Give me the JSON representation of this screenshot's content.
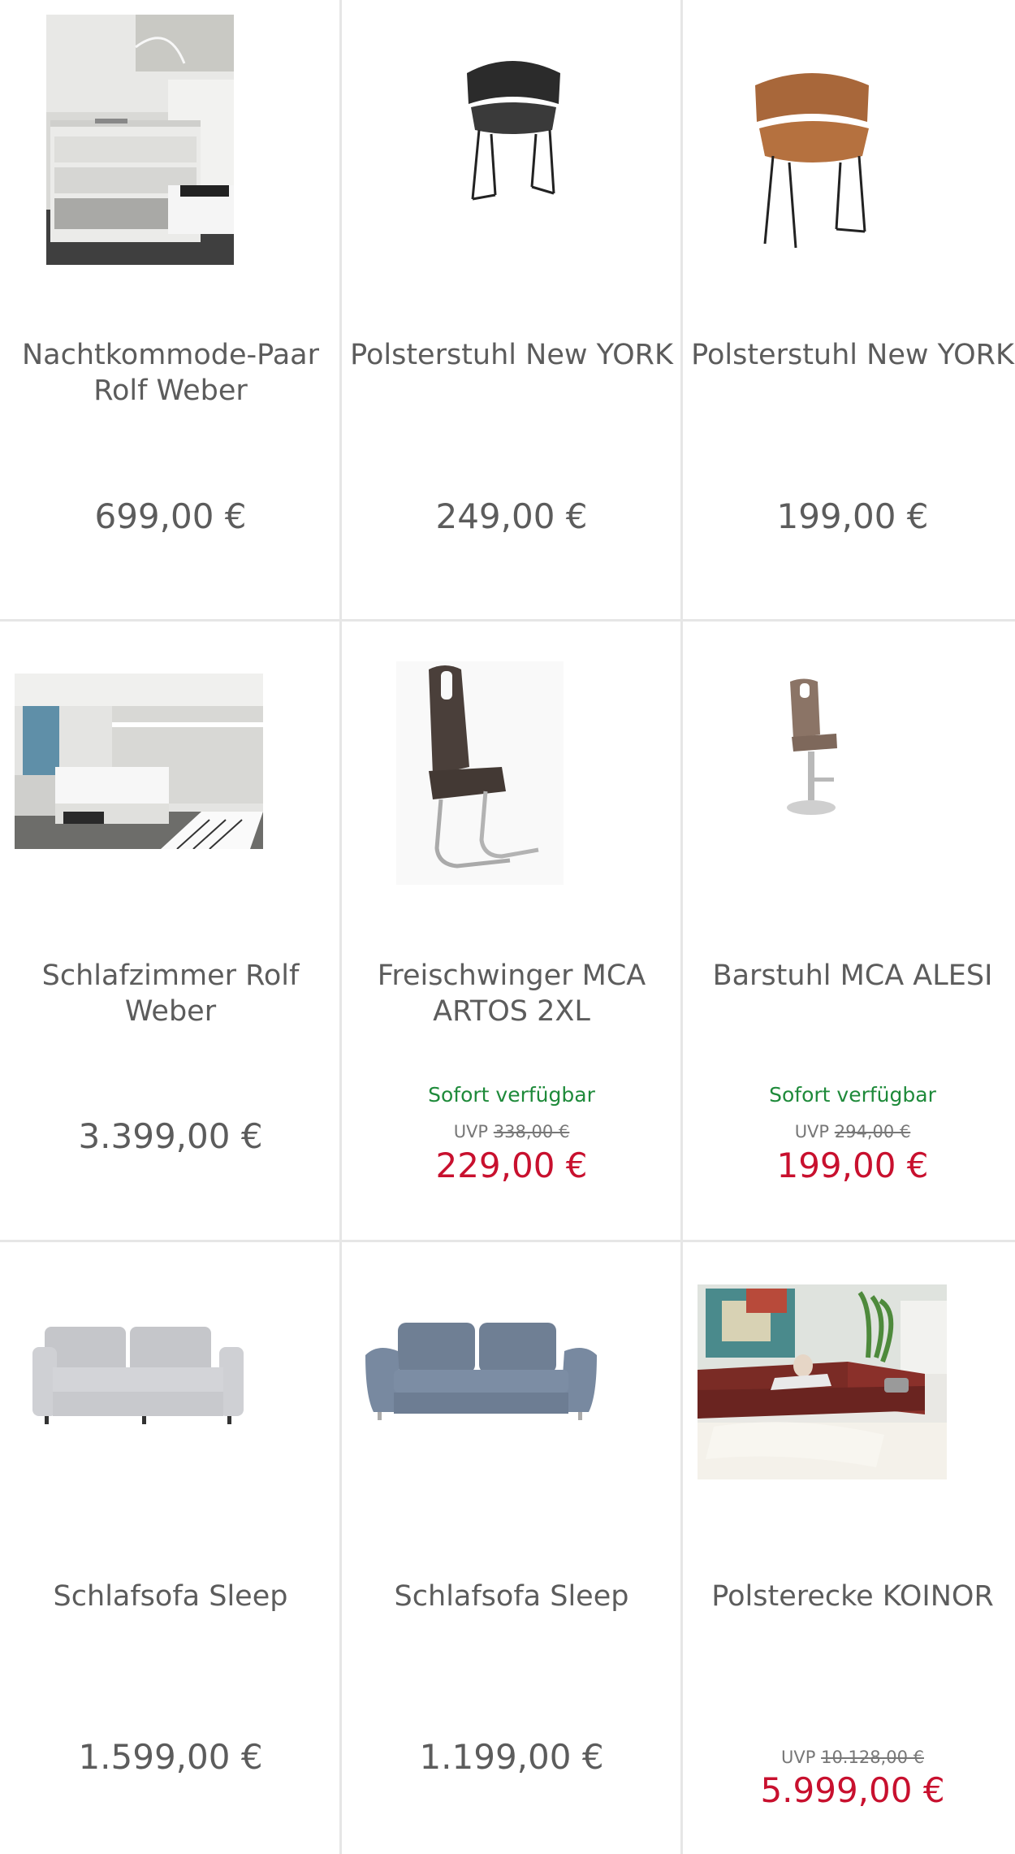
{
  "products": [
    {
      "title": "Nachtkommode-Paar Rolf Weber",
      "price": "699,00 €",
      "image_icon": "nightstand-image"
    },
    {
      "title": "Polsterstuhl New YORK",
      "price": "249,00 €",
      "image_icon": "black-chair-image"
    },
    {
      "title": "Polsterstuhl New YORK",
      "price": "199,00 €",
      "image_icon": "cognac-chair-image"
    },
    {
      "title": "Schlafzimmer Rolf Weber",
      "price": "3.399,00 €",
      "image_icon": "bedroom-image"
    },
    {
      "title": "Freischwinger MCA ARTOS 2XL",
      "availability": "Sofort verfügbar",
      "uvp_label": "UVP",
      "uvp_price": "338,00 €",
      "price": "229,00 €",
      "image_icon": "cantilever-chair-image"
    },
    {
      "title": "Barstuhl MCA ALESI",
      "availability": "Sofort verfügbar",
      "uvp_label": "UVP",
      "uvp_price": "294,00 €",
      "price": "199,00 €",
      "image_icon": "bar-stool-image"
    },
    {
      "title": "Schlafsofa Sleep",
      "price": "1.599,00 €",
      "image_icon": "light-grey-sofa-image"
    },
    {
      "title": "Schlafsofa Sleep",
      "price": "1.199,00 €",
      "image_icon": "blue-grey-sofa-image"
    },
    {
      "title": "Polsterecke KOINOR",
      "uvp_label": "UVP",
      "uvp_price": "10.128,00 €",
      "price": "5.999,00 €",
      "image_icon": "corner-sofa-image"
    }
  ],
  "colors": {
    "text": "#5c5c5c",
    "sale_price": "#c8102e",
    "availability": "#1e8a3a",
    "grid_line": "#e6e6e6"
  }
}
